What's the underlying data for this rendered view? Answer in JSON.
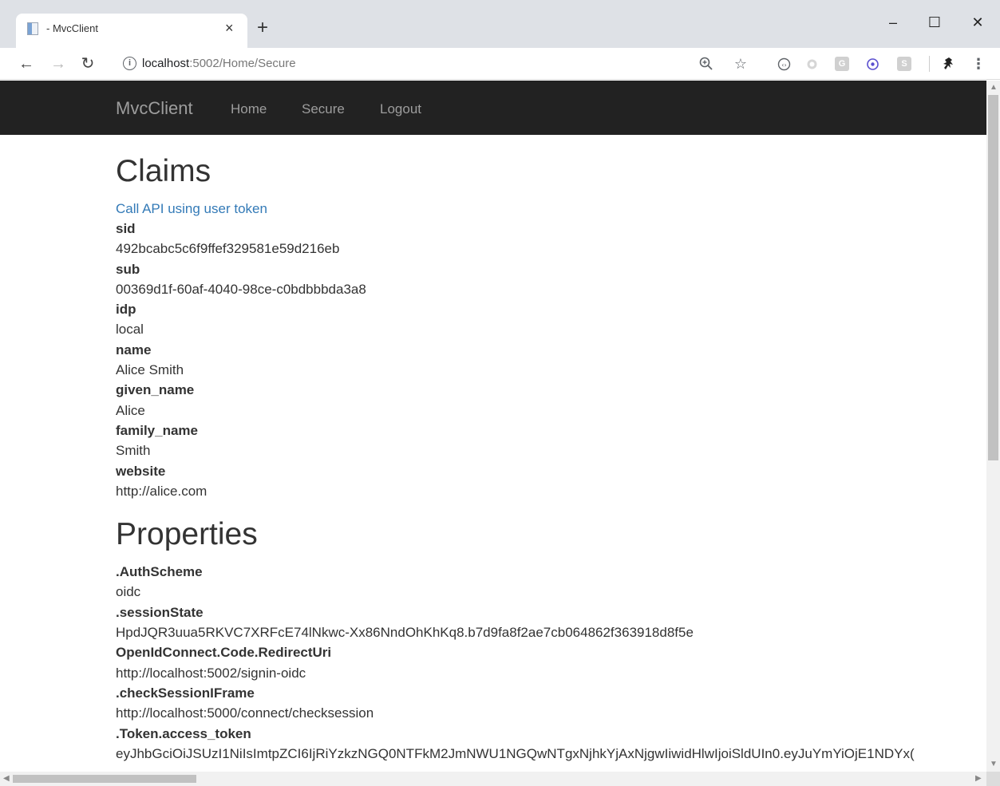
{
  "browser": {
    "tab_title": "- MvcClient",
    "tab_close": "×",
    "new_tab": "+",
    "url_host": "localhost",
    "url_rest": ":5002/Home/Secure",
    "window_controls": {
      "minimize": "–",
      "maximize": "☐",
      "close": "✕"
    },
    "nav": {
      "back": "←",
      "forward": "→",
      "reload": "↻"
    },
    "extension_labels": {
      "g": "G",
      "s": "S"
    }
  },
  "navbar": {
    "brand": "MvcClient",
    "links": [
      "Home",
      "Secure",
      "Logout"
    ]
  },
  "claims": {
    "heading": "Claims",
    "api_link": "Call API using user token",
    "items": [
      {
        "key": "sid",
        "value": "492bcabc5c6f9ffef329581e59d216eb"
      },
      {
        "key": "sub",
        "value": "00369d1f-60af-4040-98ce-c0bdbbbda3a8"
      },
      {
        "key": "idp",
        "value": "local"
      },
      {
        "key": "name",
        "value": "Alice Smith"
      },
      {
        "key": "given_name",
        "value": "Alice"
      },
      {
        "key": "family_name",
        "value": "Smith"
      },
      {
        "key": "website",
        "value": "http://alice.com"
      }
    ]
  },
  "properties": {
    "heading": "Properties",
    "items": [
      {
        "key": ".AuthScheme",
        "value": "oidc"
      },
      {
        "key": ".sessionState",
        "value": "HpdJQR3uua5RKVC7XRFcE74lNkwc-Xx86NndOhKhKq8.b7d9fa8f2ae7cb064862f363918d8f5e"
      },
      {
        "key": "OpenIdConnect.Code.RedirectUri",
        "value": "http://localhost:5002/signin-oidc"
      },
      {
        "key": ".checkSessionIFrame",
        "value": "http://localhost:5000/connect/checksession"
      },
      {
        "key": ".Token.access_token",
        "value": "eyJhbGciOiJSUzI1NiIsImtpZCI6IjRiYzkzNGQ0NTFkM2JmNWU1NGQwNTgxNjhkYjAxNjgwIiwidHlwIjoiSldUIn0.eyJuYmYiOjE1NDYx("
      }
    ]
  },
  "colors": {
    "navbar_bg": "#222222",
    "navbar_text": "#9d9d9d",
    "link": "#337ab7",
    "text": "#333333"
  }
}
